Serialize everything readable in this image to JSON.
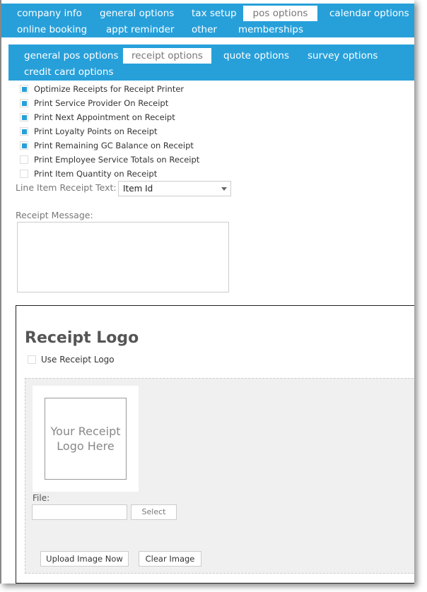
{
  "main_tabs": [
    {
      "label": "company info",
      "active": false
    },
    {
      "label": "general options",
      "active": false
    },
    {
      "label": "tax setup",
      "active": false
    },
    {
      "label": "pos options",
      "active": true
    },
    {
      "label": "calendar options",
      "active": false
    },
    {
      "label": "online booking",
      "active": false
    },
    {
      "label": "appt reminder",
      "active": false
    },
    {
      "label": "other",
      "active": false
    },
    {
      "label": "memberships",
      "active": false
    }
  ],
  "sub_tabs": [
    {
      "label": "general pos options",
      "active": false
    },
    {
      "label": "receipt options",
      "active": true
    },
    {
      "label": "quote options",
      "active": false
    },
    {
      "label": "survey options",
      "active": false
    },
    {
      "label": "credit card options",
      "active": false
    }
  ],
  "options": [
    {
      "label": "Optimize Receipts for Receipt Printer",
      "checked": true
    },
    {
      "label": "Print Service Provider On Receipt",
      "checked": true
    },
    {
      "label": "Print Next Appointment on Receipt",
      "checked": true
    },
    {
      "label": "Print Loyalty Points on Receipt",
      "checked": true
    },
    {
      "label": "Print Remaining GC Balance on Receipt",
      "checked": true
    },
    {
      "label": "Print Employee Service Totals on Receipt",
      "checked": false
    },
    {
      "label": "Print Item Quantity on Receipt",
      "checked": false
    }
  ],
  "line_item": {
    "label": "Line Item Receipt Text:",
    "value": "Item Id"
  },
  "receipt_message": {
    "label": "Receipt Message:",
    "value": ""
  },
  "logo": {
    "title": "Receipt Logo",
    "use_label": "Use Receipt Logo",
    "use_checked": false,
    "placeholder": "Your Receipt Logo Here",
    "file_label": "File:",
    "file_value": "",
    "select_label": "Select",
    "upload_label": "Upload Image Now",
    "clear_label": "Clear Image"
  },
  "colors": {
    "accent": "#27a0da"
  }
}
